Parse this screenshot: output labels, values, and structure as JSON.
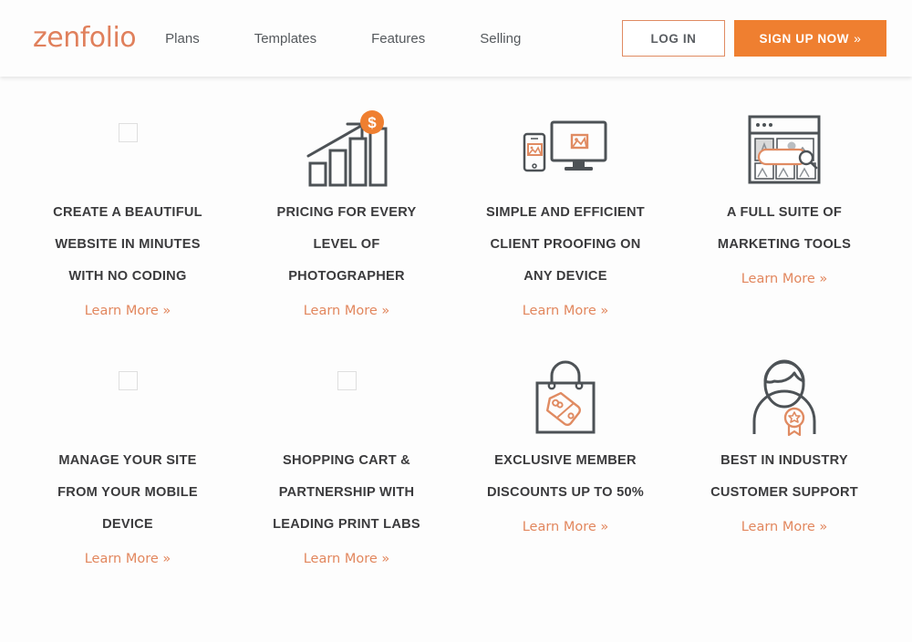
{
  "header": {
    "logo_text": "zenfolio",
    "nav": [
      {
        "label": "Plans"
      },
      {
        "label": "Templates"
      },
      {
        "label": "Features"
      },
      {
        "label": "Selling"
      }
    ],
    "login_label": "LOG IN",
    "signup_label": "SIGN UP NOW",
    "signup_chevron": "»"
  },
  "colors": {
    "brand_orange": "#ef7f30",
    "logo_orange": "#e0805c",
    "link_orange": "#e2875e",
    "icon_gray": "#4d5256",
    "heading_gray": "#3b3b3d",
    "page_background": "#fdfdfd"
  },
  "features": {
    "learn_more_label": "Learn More »",
    "row1": [
      {
        "icon": "broken-image-placeholder",
        "title_lines": [
          "CREATE A BEAUTIFUL",
          "WEBSITE IN MINUTES",
          "WITH NO CODING"
        ],
        "link": "Learn More »"
      },
      {
        "icon": "growth-chart-dollar-icon",
        "title_lines": [
          "PRICING FOR EVERY",
          "LEVEL OF",
          "PHOTOGRAPHER"
        ],
        "link": "Learn More »"
      },
      {
        "icon": "phone-and-monitor-icon",
        "title_lines": [
          "SIMPLE AND EFFICIENT",
          "CLIENT PROOFING ON",
          "ANY DEVICE"
        ],
        "link": "Learn More »"
      },
      {
        "icon": "browser-gallery-search-icon",
        "title_lines": [
          "A FULL SUITE OF",
          "MARKETING TOOLS"
        ],
        "link": "Learn More »"
      }
    ],
    "row2": [
      {
        "icon": "broken-image-placeholder",
        "title_lines": [
          "MANAGE YOUR SITE",
          "FROM YOUR MOBILE",
          "DEVICE"
        ],
        "link": "Learn More »"
      },
      {
        "icon": "broken-image-placeholder",
        "title_lines": [
          "SHOPPING CART &",
          "PARTNERSHIP WITH",
          "LEADING PRINT LABS"
        ],
        "link": "Learn More »"
      },
      {
        "icon": "shopping-bag-tag-icon",
        "title_lines": [
          "EXCLUSIVE MEMBER",
          "DISCOUNTS UP TO 50%"
        ],
        "link": "Learn More »"
      },
      {
        "icon": "person-award-badge-icon",
        "title_lines": [
          "BEST IN INDUSTRY",
          "CUSTOMER SUPPORT"
        ],
        "link": "Learn More »"
      }
    ]
  }
}
